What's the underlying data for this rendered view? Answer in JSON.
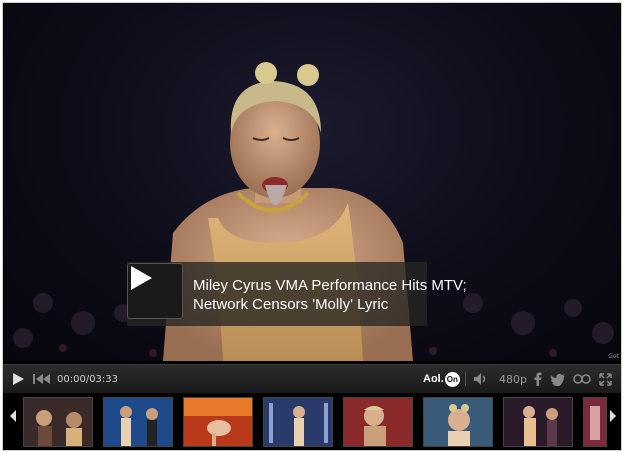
{
  "video": {
    "title_line1": "Miley Cyrus VMA Performance Hits MTV;",
    "title_line2": "Network Censors 'Molly' Lyric",
    "credit": "Get"
  },
  "controls": {
    "time": "00:00/03:33",
    "brand": "Aol.",
    "brand_on": "On",
    "quality": "480p"
  },
  "thumbnails": [
    {
      "label": "thumbnail-1",
      "color": "#6b4a3a"
    },
    {
      "label": "thumbnail-2",
      "color": "#1f4a8a"
    },
    {
      "label": "thumbnail-3",
      "color": "#b83a1a"
    },
    {
      "label": "thumbnail-4",
      "color": "#2a3a6a"
    },
    {
      "label": "thumbnail-5",
      "color": "#8a2a2a"
    },
    {
      "label": "thumbnail-6",
      "color": "#3a5a7a"
    },
    {
      "label": "thumbnail-7",
      "color": "#5a3a4a"
    },
    {
      "label": "thumbnail-8",
      "color": "#7a2a3a"
    }
  ],
  "colors": {
    "accent": "#ffffff",
    "bar": "#1f1f1f"
  }
}
